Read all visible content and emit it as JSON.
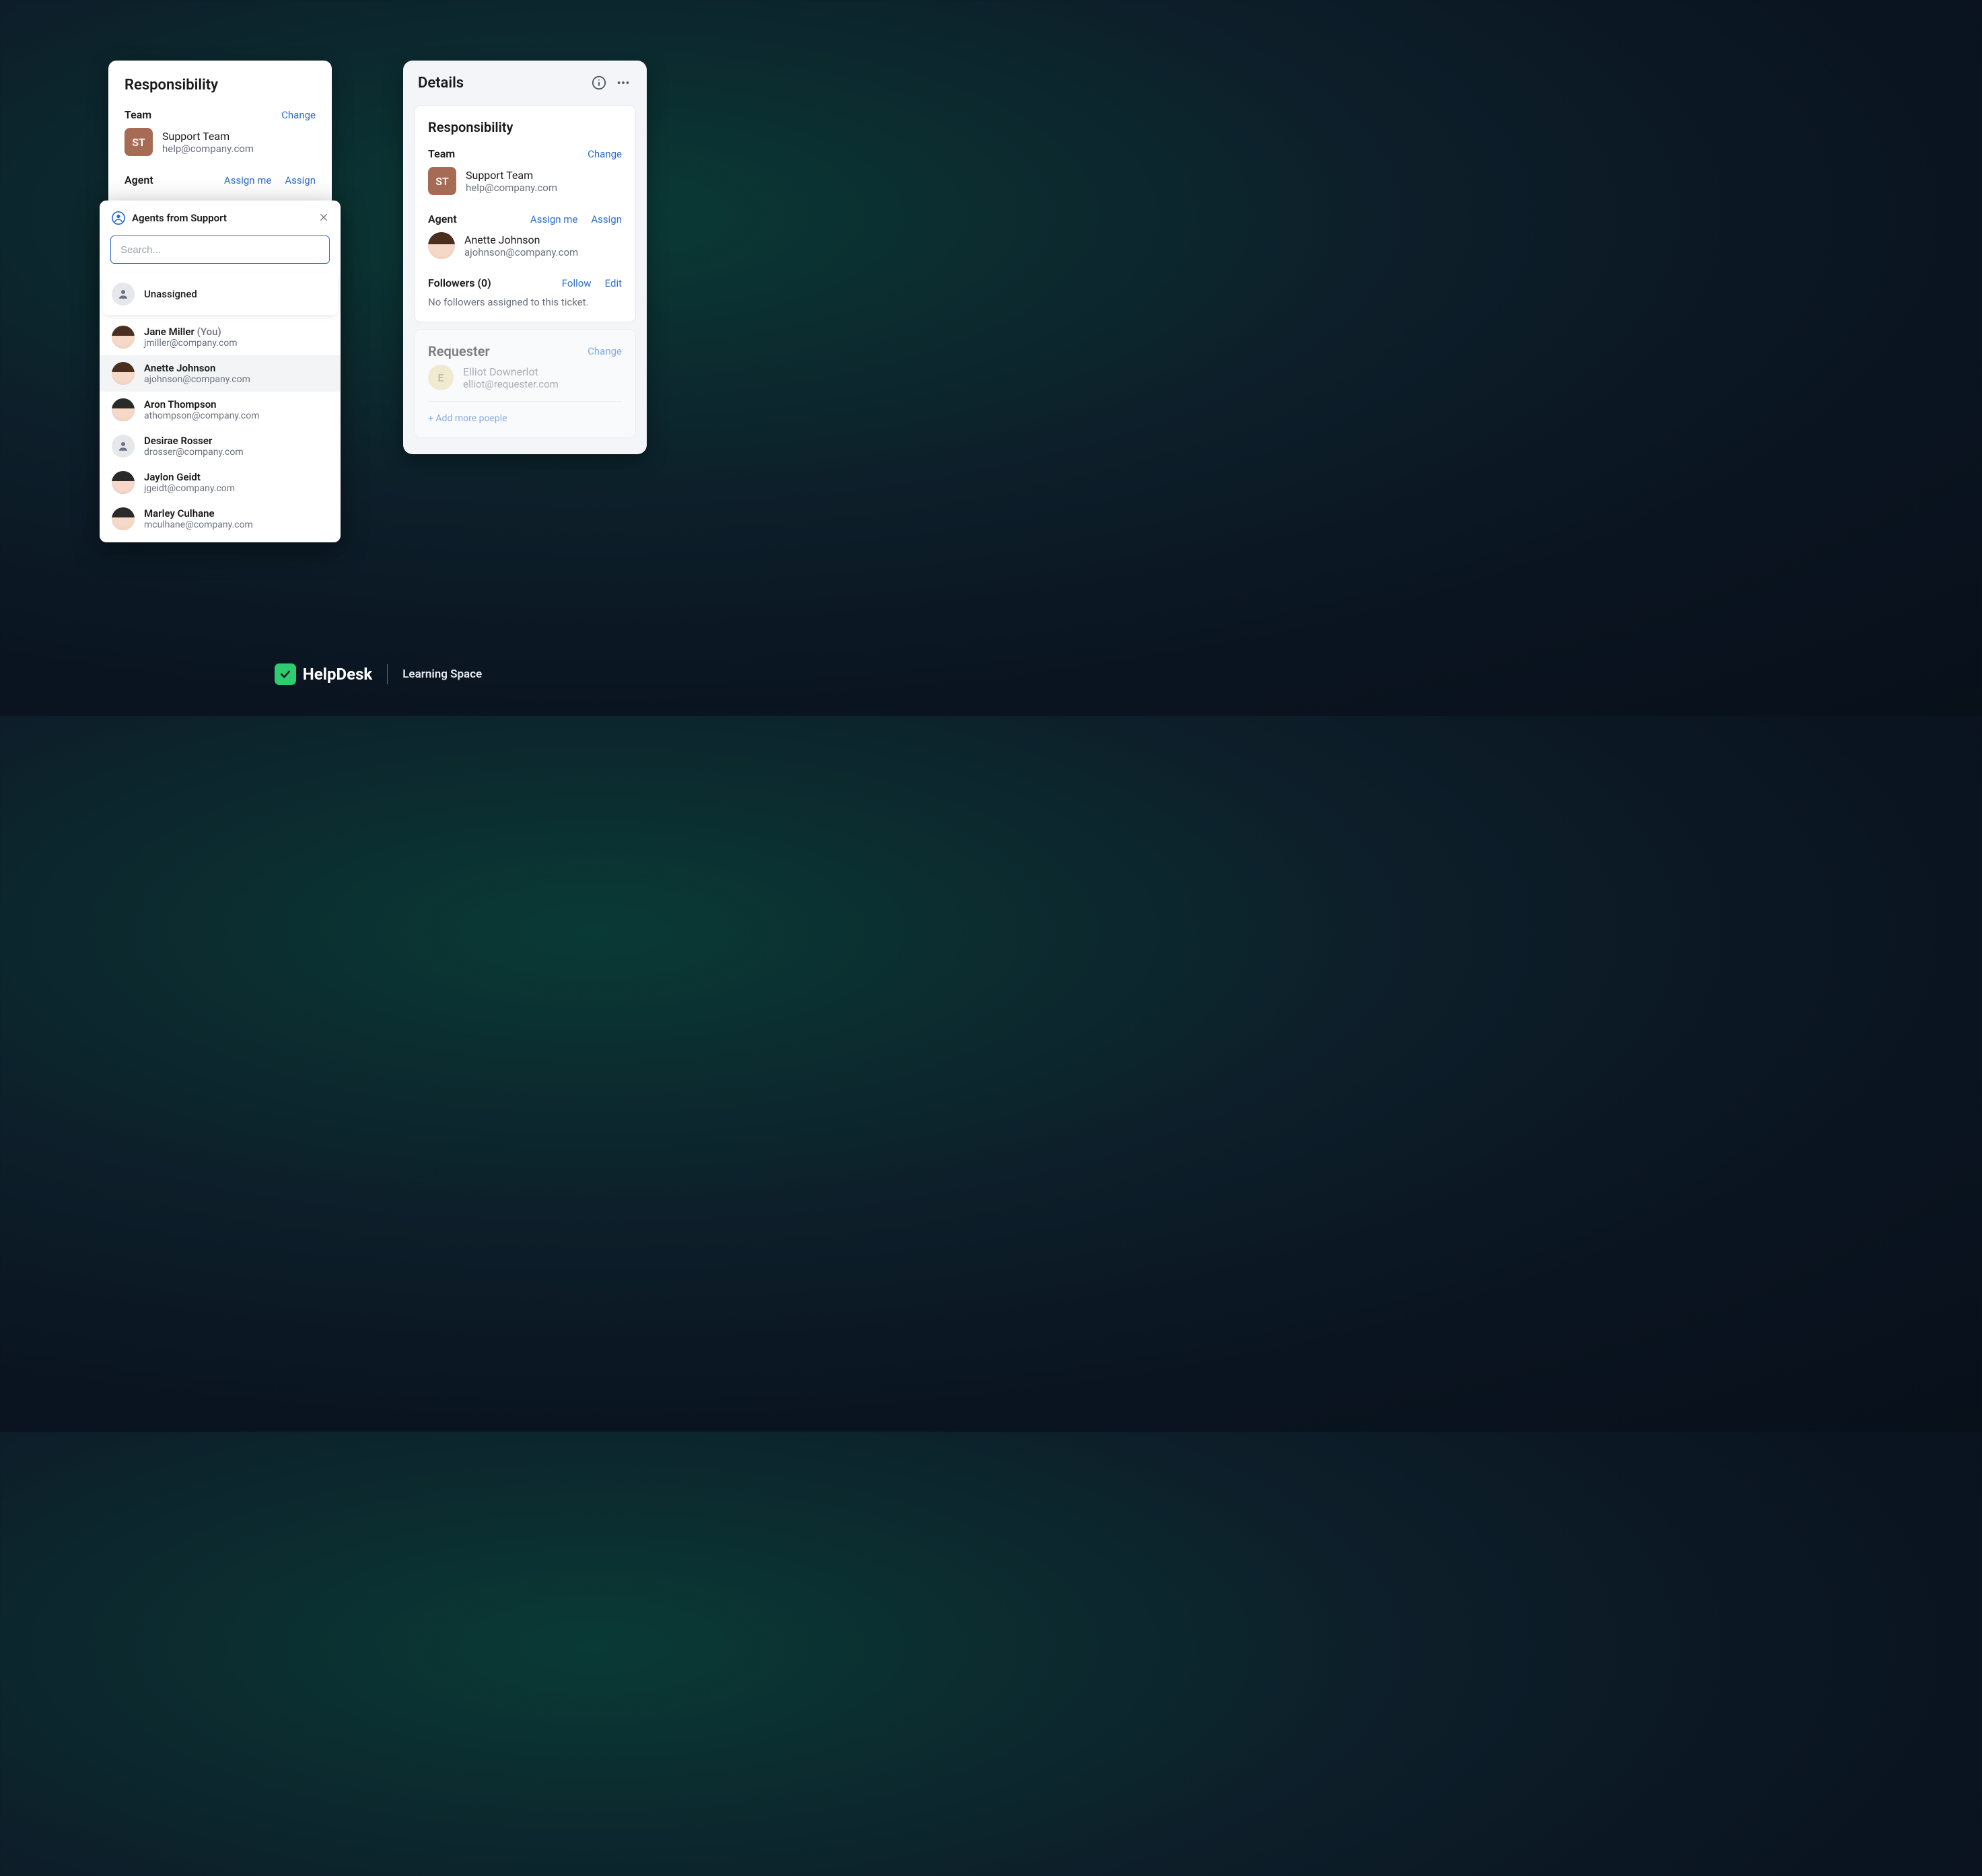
{
  "left": {
    "title": "Responsibility",
    "team": {
      "label": "Team",
      "change": "Change",
      "badge": "ST",
      "name": "Support Team",
      "email": "help@company.com"
    },
    "agent": {
      "label": "Agent",
      "assign_me": "Assign me",
      "assign": "Assign"
    }
  },
  "popup": {
    "title": "Agents from Support",
    "search_placeholder": "Search...",
    "unassigned": "Unassigned",
    "you_suffix": "(You)",
    "agents": [
      {
        "name": "Jane Miller",
        "email": "jmiller@company.com",
        "is_you": true
      },
      {
        "name": "Anette Johnson",
        "email": "ajohnson@company.com",
        "highlighted": true
      },
      {
        "name": "Aron Thompson",
        "email": "athompson@company.com"
      },
      {
        "name": "Desirae Rosser",
        "email": "drosser@company.com"
      },
      {
        "name": "Jaylon Geidt",
        "email": "jgeidt@company.com"
      },
      {
        "name": "Marley Culhane",
        "email": "mculhane@company.com"
      }
    ]
  },
  "right": {
    "header": "Details",
    "responsibility": {
      "title": "Responsibility",
      "team": {
        "label": "Team",
        "change": "Change",
        "badge": "ST",
        "name": "Support Team",
        "email": "help@company.com"
      },
      "agent": {
        "label": "Agent",
        "assign_me": "Assign me",
        "assign": "Assign",
        "name": "Anette Johnson",
        "email": "ajohnson@company.com"
      },
      "followers": {
        "label": "Followers (0)",
        "follow": "Follow",
        "edit": "Edit",
        "empty": "No followers assigned to this ticket."
      }
    },
    "requester": {
      "title": "Requester",
      "change": "Change",
      "initial": "E",
      "name": "Elliot Downerlot",
      "email": "elliot@requester.com",
      "add_more": "+ Add more poeple"
    }
  },
  "footer": {
    "brand": "HelpDesk",
    "subtitle": "Learning Space"
  }
}
